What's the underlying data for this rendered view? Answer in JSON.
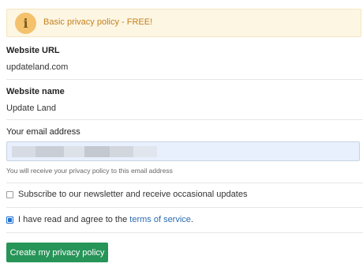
{
  "banner": {
    "icon": "info-icon",
    "text": "Basic privacy policy - FREE!"
  },
  "website_url": {
    "label": "Website URL",
    "value": "updateland.com"
  },
  "website_name": {
    "label": "Website name",
    "value": "Update Land"
  },
  "email": {
    "label": "Your email address",
    "value": "",
    "hint": "You will receive your privacy policy to this email address"
  },
  "newsletter": {
    "label": "Subscribe to our newsletter and receive occasional updates",
    "checked": false
  },
  "terms": {
    "label_prefix": "I have read and agree to the ",
    "link_text": "terms of service",
    "label_suffix": ".",
    "checked": true
  },
  "submit": {
    "label": "Create my privacy policy"
  },
  "colors": {
    "accent": "#279458",
    "link": "#2a6bb3",
    "banner_bg": "#fdf6e3",
    "banner_text": "#c4811f",
    "input_bg": "#e8f0fe"
  }
}
